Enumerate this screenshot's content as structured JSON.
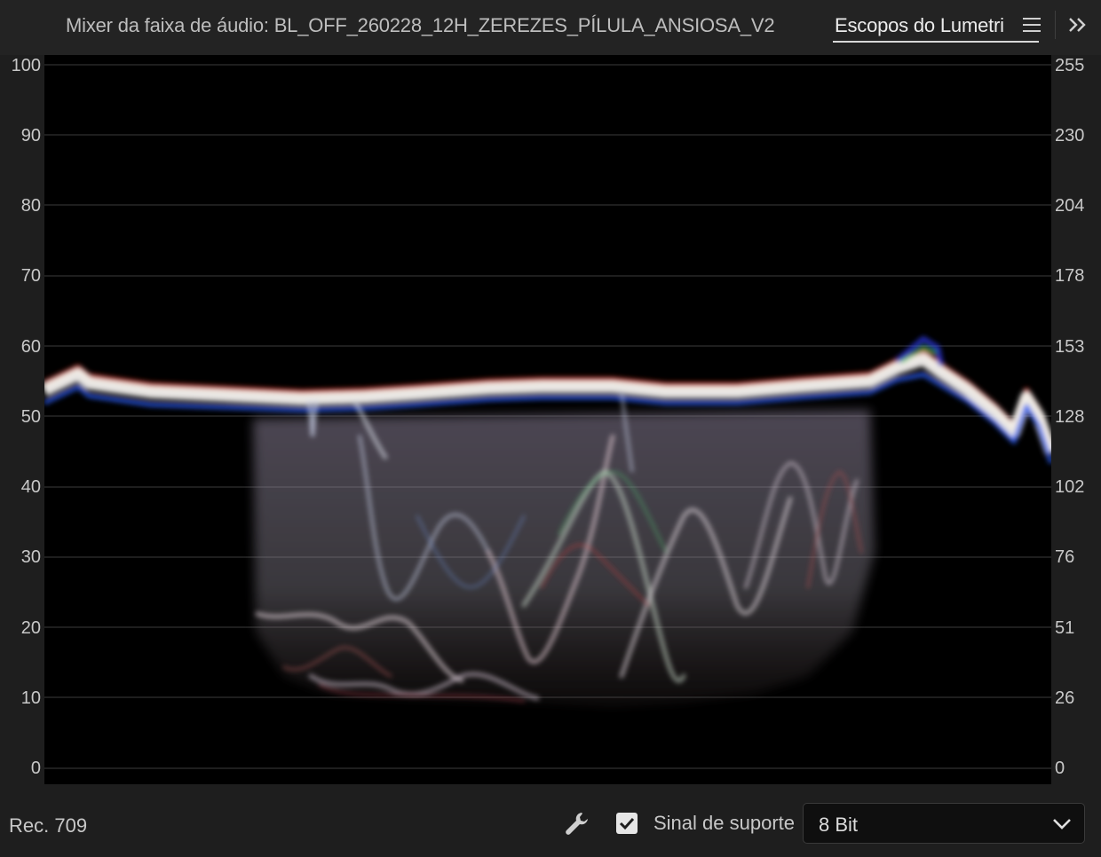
{
  "header": {
    "inactive_tab": "Mixer da faixa de áudio: BL_OFF_260228_12H_ZEREZES_PÍLULA_ANSIOSA_V2",
    "active_tab": "Escopos do Lumetri",
    "menu_icon": "hamburger-menu-icon",
    "expand_icon": "double-chevron-right-icon"
  },
  "scope": {
    "type": "waveform-rgb",
    "left_axis": [
      "100",
      "90",
      "80",
      "70",
      "60",
      "50",
      "40",
      "30",
      "20",
      "10",
      "0"
    ],
    "right_axis": [
      "255",
      "230",
      "204",
      "178",
      "153",
      "128",
      "102",
      "76",
      "51",
      "26",
      "0"
    ],
    "grid": true
  },
  "footer": {
    "colorspace": "Rec. 709",
    "wrench_icon": "wrench-icon",
    "clamp_signal_label": "Sinal de suporte",
    "clamp_signal_checked": true,
    "bit_depth": "8 Bit"
  },
  "colors": {
    "panel_bg": "#1e1e1e",
    "scope_bg": "#000000",
    "text": "#c8c8c8"
  }
}
